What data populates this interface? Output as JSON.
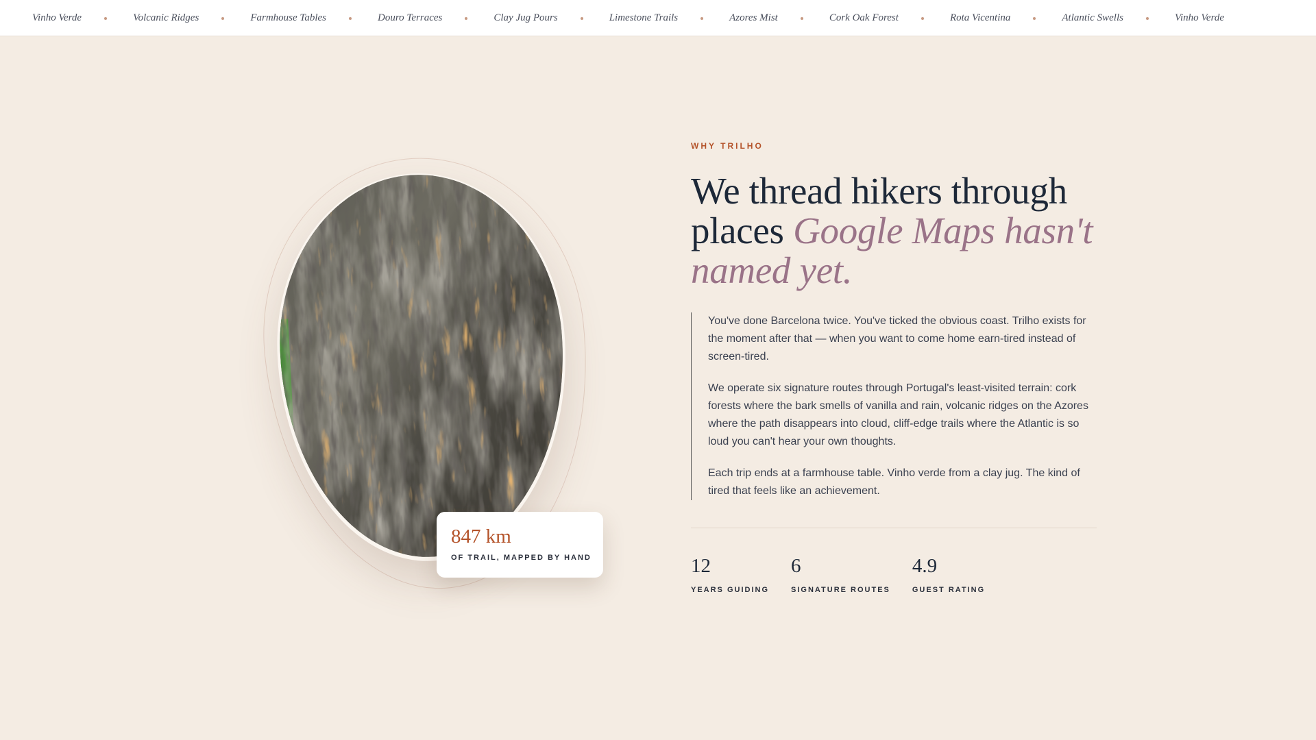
{
  "ticker": {
    "items": [
      "Vinho Verde",
      "Volcanic Ridges",
      "Farmhouse Tables",
      "Douro Terraces",
      "Clay Jug Pours",
      "Limestone Trails",
      "Azores Mist",
      "Cork Oak Forest",
      "Rota Vicentina",
      "Atlantic Swells",
      "Vinho Verde"
    ]
  },
  "hero_card": {
    "value": "847 km",
    "label": "OF TRAIL, MAPPED BY HAND"
  },
  "section": {
    "eyebrow": "WHY TRILHO",
    "headline_plain": "We thread hikers through places ",
    "headline_accent": "Google Maps hasn't named yet.",
    "paragraphs": [
      "You've done Barcelona twice. You've ticked the obvious coast. Trilho exists for the moment after that — when you want to come home earn-tired instead of screen-tired.",
      "We operate six signature routes through Portugal's least-visited terrain: cork forests where the bark smells of vanilla and rain, volcanic ridges on the Azores where the path disappears into cloud, cliff-edge trails where the Atlantic is so loud you can't hear your own thoughts.",
      "Each trip ends at a farmhouse table. Vinho verde from a clay jug. The kind of tired that feels like an achievement."
    ],
    "stats": [
      {
        "value": "12",
        "label": "YEARS GUIDING"
      },
      {
        "value": "6",
        "label": "SIGNATURE ROUTES"
      },
      {
        "value": "4.9",
        "label": "GUEST RATING"
      }
    ]
  },
  "colors": {
    "background": "#f4ece3",
    "accent_rust": "#b4532a",
    "accent_mauve": "#9a7388",
    "ink": "#1d2838"
  },
  "icons": {
    "ticker_separator": "dot-icon"
  }
}
